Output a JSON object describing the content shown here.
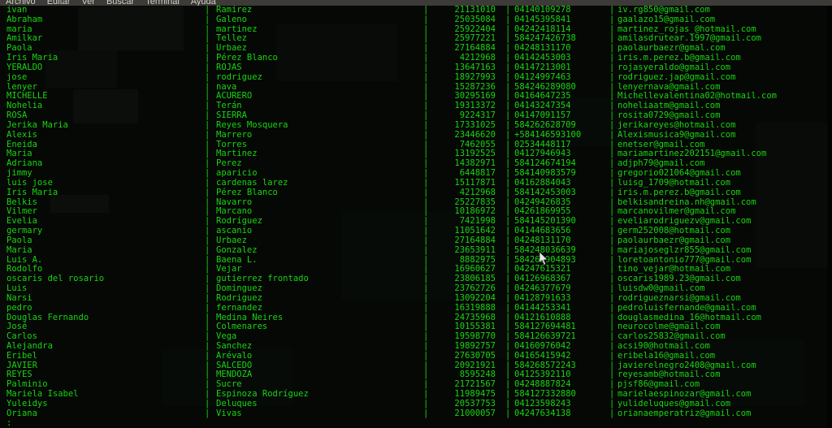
{
  "window": {
    "app": "Terminal",
    "menu": [
      {
        "label": "Archivo",
        "name": "menu-archivo"
      },
      {
        "label": "Editar",
        "name": "menu-editar"
      },
      {
        "label": "Ver",
        "name": "menu-ver"
      },
      {
        "label": "Buscar",
        "name": "menu-buscar"
      },
      {
        "label": "Terminal",
        "name": "menu-terminal"
      },
      {
        "label": "Ayuda",
        "name": "menu-ayuda"
      }
    ]
  },
  "colors": {
    "background": "#050805",
    "foreground": "#19d411",
    "menubar_background": "#3c3b37",
    "menubar_foreground": "#d3d0c8"
  },
  "terminal": {
    "separator": "|",
    "pager_prompt": ":",
    "rows": [
      {
        "first": "ivan",
        "last": "Ramírez",
        "id": "21131010",
        "phone": "04140109278",
        "email": "iv.rg850@gmail.com"
      },
      {
        "first": "Abraham",
        "last": "Galeno",
        "id": "25035084",
        "phone": "04145395841",
        "email": "gaalazo15@gmail.com"
      },
      {
        "first": "maria",
        "last": "martinez",
        "id": "25922404",
        "phone": "04242418114",
        "email": "martinez_rojas_@hotmail.com"
      },
      {
        "first": "Amilkar",
        "last": "Tellez",
        "id": "25977221",
        "phone": "584247426738",
        "email": "amilasdrutear.1997@gmail.com"
      },
      {
        "first": "Paola",
        "last": "Urbaez",
        "id": "27164884",
        "phone": "04248131170",
        "email": "paolaurbaezr@gmal.com"
      },
      {
        "first": "Iris Maria",
        "last": "Pérez Blanco",
        "id": "4212968",
        "phone": "04142453003",
        "email": "iris.m.perez.b@gmail.com"
      },
      {
        "first": "YERALDO",
        "last": "ROJAS",
        "id": "13647163",
        "phone": "04147213001",
        "email": "rojasyeraldo@gmail.com"
      },
      {
        "first": "jose",
        "last": "rodriguez",
        "id": "18927993",
        "phone": "04124997463",
        "email": "rodriguez.jap@gmail.com"
      },
      {
        "first": "lenyer",
        "last": "nava",
        "id": "15287236",
        "phone": "584246289080",
        "email": "lenyernava@gmail.com"
      },
      {
        "first": "MICHELLE",
        "last": "ACURERO",
        "id": "30295169",
        "phone": "04164647235",
        "email": "Michellevalentina02@hotmail.com"
      },
      {
        "first": "Nohelia",
        "last": "Terán",
        "id": "19313372",
        "phone": "04143247354",
        "email": "noheliaatm@gmail.com"
      },
      {
        "first": "ROSA",
        "last": "SIERRA",
        "id": "9224317",
        "phone": "04147091157",
        "email": "rosita0729@gmail.com"
      },
      {
        "first": "Jerika Maria",
        "last": "Reyes Mosquera",
        "id": "17331025",
        "phone": "584262628709",
        "email": "jerikareyes@hotmail.com"
      },
      {
        "first": "Alexis",
        "last": "Marrero",
        "id": "23446620",
        "phone": "+584146593100",
        "email": "Alexismusica9@gmail.com"
      },
      {
        "first": "Eneida",
        "last": "Torres",
        "id": "7462055",
        "phone": "02534448117",
        "email": "enetser@gmail.com"
      },
      {
        "first": "Maria",
        "last": "Martinez",
        "id": "13192525",
        "phone": "04127946943",
        "email": "mariamartinez202151@gmail.com"
      },
      {
        "first": "Adriana",
        "last": "Perez",
        "id": "14382971",
        "phone": "584124674194",
        "email": "adjph79@gmail.com"
      },
      {
        "first": "jimmy",
        "last": "aparicio",
        "id": "6448817",
        "phone": "584140983579",
        "email": "gregorio021064@gmail.com"
      },
      {
        "first": "luis jose",
        "last": "cardenas larez",
        "id": "15117871",
        "phone": "04162884043",
        "email": "luisg_1709@hotmail.com"
      },
      {
        "first": "Iris Maria",
        "last": "Pérez Blanco",
        "id": "4212968",
        "phone": "584142453003",
        "email": "iris.m.perez.b@gmail.com"
      },
      {
        "first": "Belkis",
        "last": "Navarro",
        "id": "25227835",
        "phone": "04249426835",
        "email": "belkisandreina.nh@gmail.com"
      },
      {
        "first": "Vilmer",
        "last": "Marcano",
        "id": "10186972",
        "phone": "04261869955",
        "email": "marcanovilmer@gmail.com"
      },
      {
        "first": "Evelia",
        "last": "Rodríguez",
        "id": "7421998",
        "phone": "584145201390",
        "email": "eveliarodriguezv@gmail.com"
      },
      {
        "first": "germary",
        "last": "ascanio",
        "id": "11051642",
        "phone": "04144683656",
        "email": "germ252008@hotmail.com"
      },
      {
        "first": "Paola",
        "last": "Urbaez",
        "id": "27164884",
        "phone": "04248131170",
        "email": "paolaurbaezr@gmail.com"
      },
      {
        "first": "Maria",
        "last": "Gonzalez",
        "id": "23653911",
        "phone": "584248036639",
        "email": "mariajoseglzr855@gmail.com"
      },
      {
        "first": "Luis A.",
        "last": "Baena L.",
        "id": "8882975",
        "phone": "584265904893",
        "email": "loretoantonio777@gmail.com"
      },
      {
        "first": "Rodolfo",
        "last": "Vejar",
        "id": "16960627",
        "phone": "04247615321",
        "email": "tino_vejar@hotmail.com"
      },
      {
        "first": "oscaris del rosario",
        "last": "gutierrez frontado",
        "id": "23806185",
        "phone": "04126968367",
        "email": "oscaris1989.23@gmail.com"
      },
      {
        "first": "Luis",
        "last": "Dominguez",
        "id": "23762726",
        "phone": "04246377679",
        "email": "luisdw0@gmail.com"
      },
      {
        "first": "Narsi",
        "last": "Rodriguez",
        "id": "13092204",
        "phone": "04128791633",
        "email": "rodrigueznarsi@gmail.com"
      },
      {
        "first": "pedro",
        "last": "fernandez",
        "id": "16319888",
        "phone": "04144253341",
        "email": "pedroluisfernande@gmail.com"
      },
      {
        "first": "Douglas Fernando",
        "last": "Medina Neires",
        "id": "24735968",
        "phone": "04121610888",
        "email": "douglasmedina_16@hotmail.com"
      },
      {
        "first": "José",
        "last": "Colmenares",
        "id": "10155381",
        "phone": "584127694481",
        "email": "neurocolme@gmail.com"
      },
      {
        "first": "Carlos",
        "last": "Vega",
        "id": "19598770",
        "phone": "584126639721",
        "email": "carlos25832@gmail.com"
      },
      {
        "first": "Alejandra",
        "last": "Sanchez",
        "id": "19892757",
        "phone": "04160976042",
        "email": "acsi90@hotmail.com"
      },
      {
        "first": "Eribel",
        "last": "Arévalo",
        "id": "27630705",
        "phone": "04165415942",
        "email": "eribela16@gmail.com"
      },
      {
        "first": "JAVIER",
        "last": "SALCEDO",
        "id": "20921921",
        "phone": "584268572243",
        "email": "javierelnegro2408@gmail.com"
      },
      {
        "first": "REYES",
        "last": "MENDOZA",
        "id": "8595248",
        "phone": "04125392110",
        "email": "reyesamb@hotmail.com"
      },
      {
        "first": "Palminio",
        "last": "Sucre",
        "id": "21721567",
        "phone": "04248887824",
        "email": "pjsf86@gmail.com"
      },
      {
        "first": "Mariela Isabel",
        "last": "Espinoza Rodríguez",
        "id": "11989475",
        "phone": "584127332880",
        "email": "marielaespinozar@gmail.com"
      },
      {
        "first": "Yuleidys",
        "last": "Deluques",
        "id": "20537753",
        "phone": "04123598243",
        "email": "yulideluques@gmail.com"
      },
      {
        "first": "Oriana",
        "last": "Vivas",
        "id": "21000057",
        "phone": "04247634138",
        "email": "orianaemperatriz@gmail.com"
      }
    ]
  }
}
